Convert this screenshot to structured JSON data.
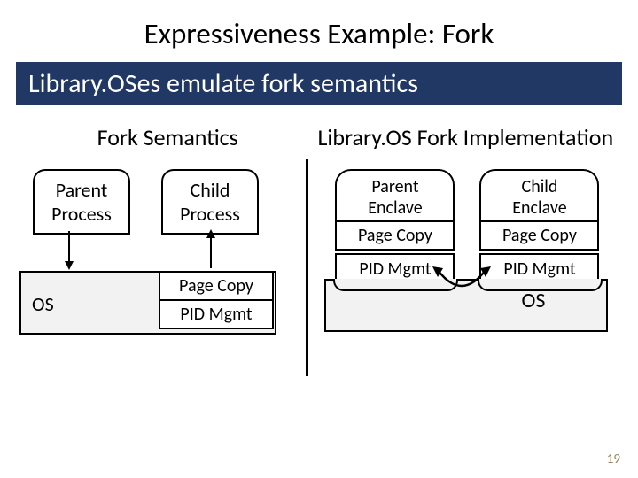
{
  "title": "Expressiveness Example: Fork",
  "banner": "Library.OSes emulate fork semantics",
  "left": {
    "heading": "Fork Semantics",
    "parent": "Parent\nProcess",
    "child": "Child\nProcess",
    "os": "OS",
    "page_copy": "Page Copy",
    "pid_mgmt": "PID Mgmt"
  },
  "right": {
    "heading": "Library.OS Fork Implementation",
    "parent_title": "Parent\nEnclave",
    "child_title": "Child\nEnclave",
    "page_copy": "Page Copy",
    "pid_mgmt": "PID Mgmt",
    "os": "OS"
  },
  "page_number": "19"
}
